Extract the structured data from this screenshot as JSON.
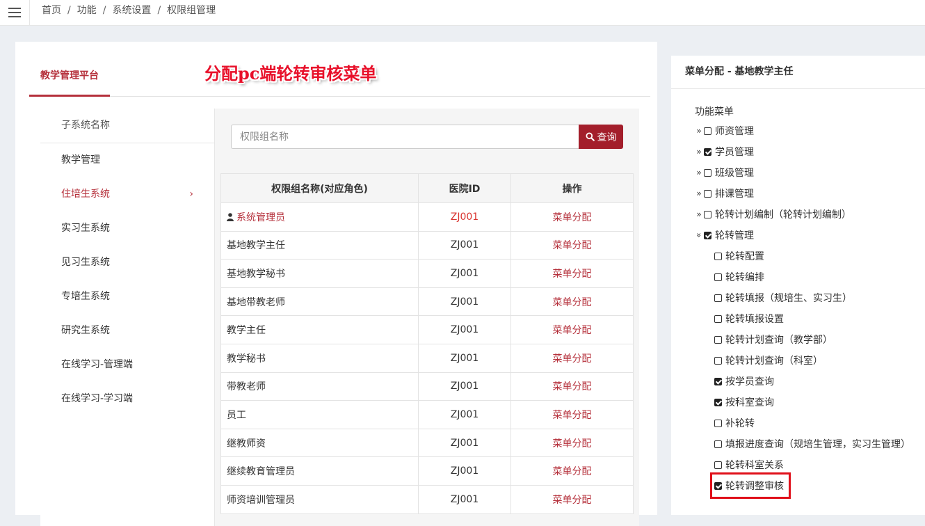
{
  "breadcrumb": [
    "首页",
    "功能",
    "系统设置",
    "权限组管理"
  ],
  "tab": {
    "label": "教学管理平台"
  },
  "annotation": "分配pc端轮转审核菜单",
  "subsystems": {
    "header": "子系统名称",
    "items": [
      {
        "label": "教学管理",
        "active": false
      },
      {
        "label": "住培生系统",
        "active": true
      },
      {
        "label": "实习生系统",
        "active": false
      },
      {
        "label": "见习生系统",
        "active": false
      },
      {
        "label": "专培生系统",
        "active": false
      },
      {
        "label": "研究生系统",
        "active": false
      },
      {
        "label": "在线学习-管理端",
        "active": false
      },
      {
        "label": "在线学习-学习端",
        "active": false
      }
    ]
  },
  "search": {
    "placeholder": "权限组名称",
    "value": "",
    "button_label": "查询"
  },
  "table": {
    "headers": [
      "权限组名称(对应角色)",
      "医院ID",
      "操作"
    ],
    "rows": [
      {
        "name": "系统管理员",
        "hospital_id": "ZJ001",
        "action": "菜单分配",
        "current_user": true
      },
      {
        "name": "基地教学主任",
        "hospital_id": "ZJ001",
        "action": "菜单分配"
      },
      {
        "name": "基地教学秘书",
        "hospital_id": "ZJ001",
        "action": "菜单分配"
      },
      {
        "name": "基地带教老师",
        "hospital_id": "ZJ001",
        "action": "菜单分配"
      },
      {
        "name": "教学主任",
        "hospital_id": "ZJ001",
        "action": "菜单分配"
      },
      {
        "name": "教学秘书",
        "hospital_id": "ZJ001",
        "action": "菜单分配"
      },
      {
        "name": "带教老师",
        "hospital_id": "ZJ001",
        "action": "菜单分配"
      },
      {
        "name": "员工",
        "hospital_id": "ZJ001",
        "action": "菜单分配"
      },
      {
        "name": "继教师资",
        "hospital_id": "ZJ001",
        "action": "菜单分配"
      },
      {
        "name": "继续教育管理员",
        "hospital_id": "ZJ001",
        "action": "菜单分配"
      },
      {
        "name": "师资培训管理员",
        "hospital_id": "ZJ001",
        "action": "菜单分配"
      }
    ]
  },
  "menu_panel": {
    "title": "菜单分配 - 基地教学主任",
    "root": "功能菜单",
    "nodes": [
      {
        "label": "师资管理",
        "level": 1,
        "expanded": false,
        "checked": false
      },
      {
        "label": "学员管理",
        "level": 1,
        "expanded": false,
        "checked": true
      },
      {
        "label": "班级管理",
        "level": 1,
        "expanded": false,
        "checked": false
      },
      {
        "label": "排课管理",
        "level": 1,
        "expanded": false,
        "checked": false
      },
      {
        "label": "轮转计划编制（轮转计划编制）",
        "level": 1,
        "expanded": false,
        "checked": false
      },
      {
        "label": "轮转管理",
        "level": 1,
        "expanded": true,
        "checked": true
      },
      {
        "label": "轮转配置",
        "level": 2,
        "checked": false
      },
      {
        "label": "轮转编排",
        "level": 2,
        "checked": false
      },
      {
        "label": "轮转填报（规培生、实习生）",
        "level": 2,
        "checked": false
      },
      {
        "label": "轮转填报设置",
        "level": 2,
        "checked": false
      },
      {
        "label": "轮转计划查询（教学部）",
        "level": 2,
        "checked": false
      },
      {
        "label": "轮转计划查询（科室）",
        "level": 2,
        "checked": false
      },
      {
        "label": "按学员查询",
        "level": 2,
        "checked": true
      },
      {
        "label": "按科室查询",
        "level": 2,
        "checked": true
      },
      {
        "label": "补轮转",
        "level": 2,
        "checked": false
      },
      {
        "label": "填报进度查询（规培生管理，实习生管理）",
        "level": 2,
        "checked": false
      },
      {
        "label": "轮转科室关系",
        "level": 2,
        "checked": false
      },
      {
        "label": "轮转调整审核",
        "level": 2,
        "checked": true,
        "highlighted": true
      }
    ]
  },
  "colors": {
    "accent": "#b5303b",
    "button": "#a31e2b",
    "annotation": "#e8102a",
    "highlight": "#e0101a"
  }
}
